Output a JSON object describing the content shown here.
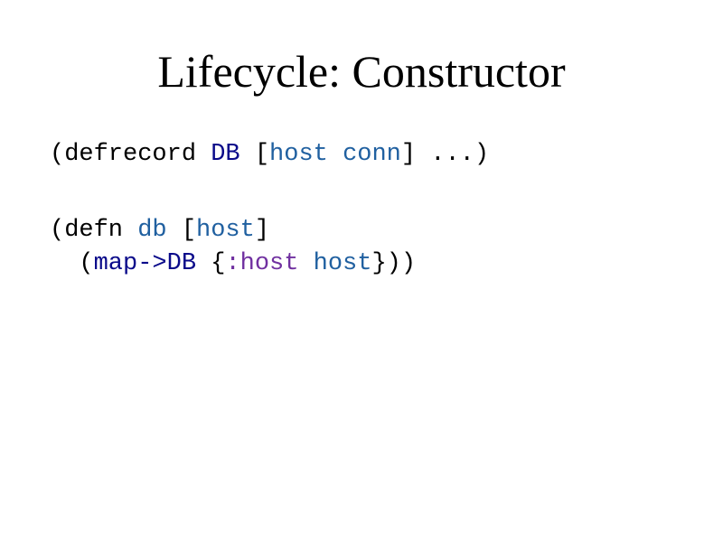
{
  "slide": {
    "title": "Lifecycle: Constructor",
    "code1": {
      "p1": "(defrecord ",
      "p2": "DB",
      "p3": " [",
      "p4": "host",
      "p5": " ",
      "p6": "conn",
      "p7": "] ...)"
    },
    "code2": {
      "line1": {
        "p1": "(defn ",
        "p2": "db",
        "p3": " [",
        "p4": "host",
        "p5": "]"
      },
      "line2": {
        "p1": "  (",
        "p2": "map->DB",
        "p3": " {",
        "p4": ":host",
        "p5": " ",
        "p6": "host",
        "p7": "}))"
      }
    }
  }
}
